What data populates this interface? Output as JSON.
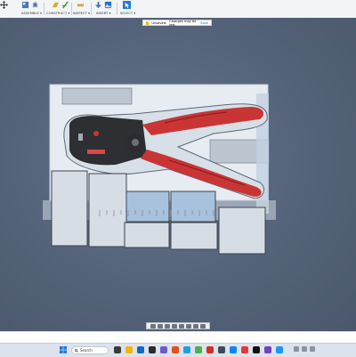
{
  "toolbar": {
    "groups": [
      {
        "label": "ASSEMBLE ▾"
      },
      {
        "label": "CONSTRUCT ▾"
      },
      {
        "label": "INSPECT ▾"
      },
      {
        "label": "INSERT ▾"
      },
      {
        "label": "SELECT ▾"
      }
    ]
  },
  "banner": {
    "status": "Unsaved:",
    "message": "Changes may be lost",
    "save_label": "Save"
  },
  "taskbar": {
    "search_placeholder": "Search"
  },
  "colors": {
    "viewport_bg": "#5a677d",
    "handle_red": "#c93535",
    "toolbar_bg": "#f3f4f6",
    "accent_blue": "#1f6fd1"
  }
}
